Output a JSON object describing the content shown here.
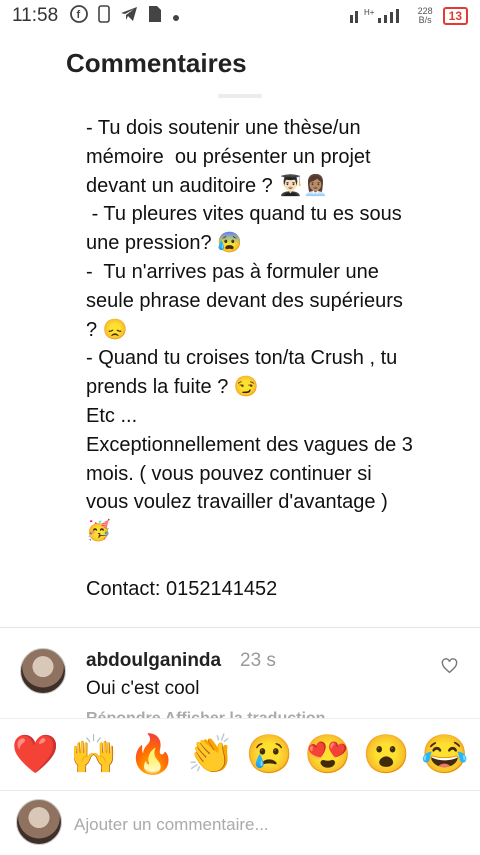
{
  "status_bar": {
    "time": "11:58",
    "battery": "13",
    "net_speed_value": "228",
    "net_speed_unit": "B/s",
    "network": "H+"
  },
  "header": {
    "title": "Commentaires"
  },
  "caption": {
    "text": "- Tu dois soutenir une thèse/un mémoire  ou présenter un projet devant un auditoire ? 👨🏻‍🎓👩🏽‍💼\n - Tu pleures vites quand tu es sous une pression? 😰\n-  Tu n'arrives pas à formuler une seule phrase devant des supérieurs ? 😞\n- Quand tu croises ton/ta Crush , tu prends la fuite ? 😏\nEtc ...\nExceptionnellement des vagues de 3 mois. ( vous pouvez continuer si vous voulez travailler d'avantage )\n🥳\n\nContact: 0152141452"
  },
  "comment": {
    "username": "abdoulganinda",
    "time": "23 s",
    "text": "Oui c'est cool",
    "actions": "Répondre    Afficher la traduction"
  },
  "emoji_bar": [
    "❤️",
    "🙌",
    "🔥",
    "👏",
    "😢",
    "😍",
    "😮",
    "😂"
  ],
  "input": {
    "placeholder": "Ajouter un commentaire..."
  }
}
